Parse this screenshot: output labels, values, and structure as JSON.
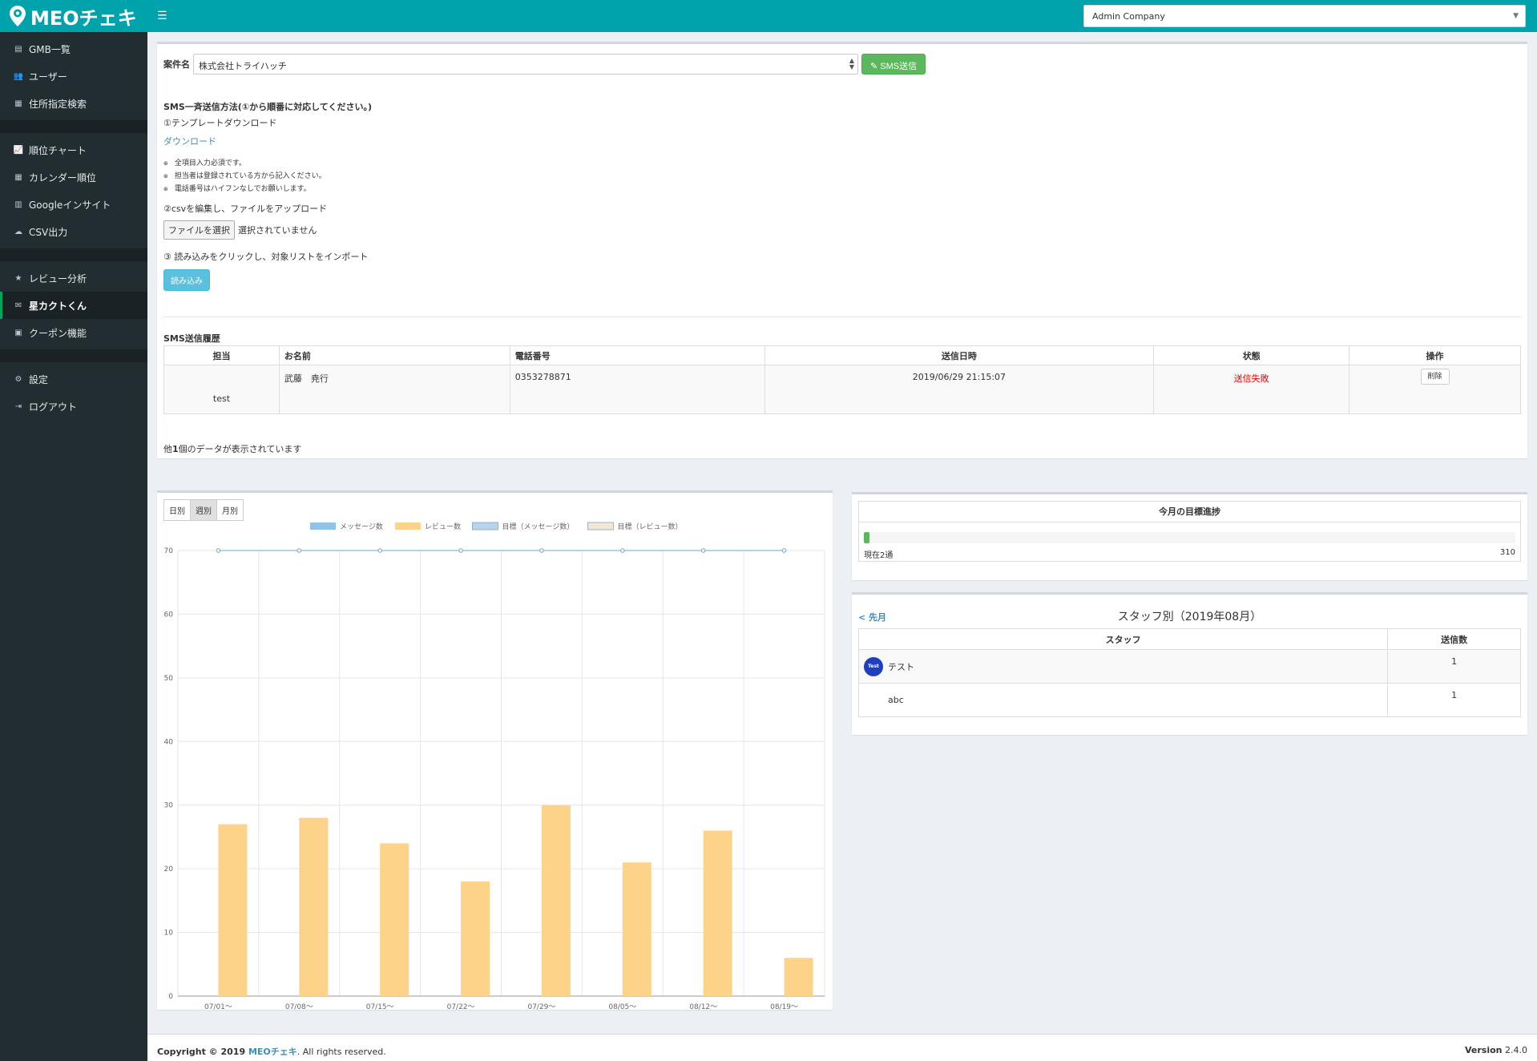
{
  "app": {
    "logo_text": "MEOチェキ"
  },
  "topbar": {
    "company": "Admin Company"
  },
  "sidebar": {
    "groups": [
      [
        {
          "label": "GMB一覧",
          "icon": "database-icon"
        },
        {
          "label": "ユーザー",
          "icon": "users-icon"
        },
        {
          "label": "住所指定検索",
          "icon": "map-icon"
        }
      ],
      [
        {
          "label": "順位チャート",
          "icon": "line-chart-icon"
        },
        {
          "label": "カレンダー順位",
          "icon": "calendar-icon"
        },
        {
          "label": "Googleインサイト",
          "icon": "bar-chart-icon"
        },
        {
          "label": "CSV出力",
          "icon": "cloud-download-icon"
        }
      ],
      [
        {
          "label": "レビュー分析",
          "icon": "star-icon"
        },
        {
          "label": "星カクトくん",
          "icon": "envelope-icon",
          "active": true
        },
        {
          "label": "クーポン機能",
          "icon": "gift-icon"
        }
      ],
      [
        {
          "label": "設定",
          "icon": "gear-icon"
        },
        {
          "label": "ログアウト",
          "icon": "sign-out-icon"
        }
      ]
    ]
  },
  "case": {
    "label": "案件名",
    "selected": "株式会社トライハッチ",
    "sms_button": "SMS送信"
  },
  "instructions": {
    "heading": "SMS一斉送信方法(①から順番に対応してください。)",
    "step1": "①テンプレートダウンロード",
    "download_link": "ダウンロード",
    "notes": [
      "全項目入力必須です。",
      "担当者は登録されている方から記入ください。",
      "電話番号はハイフンなしでお願いします。"
    ],
    "step2": "②csvを編集し、ファイルをアップロード",
    "file_button": "ファイルを選択",
    "file_status": "選択されていません",
    "step3": "③ 読み込みをクリックし、対象リストをインポート",
    "load_button": "読み込み"
  },
  "history": {
    "title": "SMS送信履歴",
    "columns": [
      "担当",
      "お名前",
      "電話番号",
      "送信日時",
      "状態",
      "操作"
    ],
    "rows": [
      {
        "staff": "test",
        "name": "武藤　尭行",
        "phone": "0353278871",
        "sent_at": "2019/06/29 21:15:07",
        "status": "送信失敗",
        "action": "削除"
      }
    ],
    "count_prefix": "他",
    "count_value": "1",
    "count_suffix": "個のデータが表示されています"
  },
  "chart_tabs": [
    "日別",
    "週別",
    "月別"
  ],
  "chart_tab_active": 1,
  "chart_data": {
    "type": "bar",
    "categories": [
      "07/01～",
      "07/08～",
      "07/15～",
      "07/22～",
      "07/29～",
      "08/05～",
      "08/12～",
      "08/19～"
    ],
    "series": [
      {
        "name": "メッセージ数",
        "type": "bar",
        "color": "#8ec3ea",
        "values": [
          0,
          0,
          0,
          0,
          0,
          0,
          0,
          0
        ]
      },
      {
        "name": "レビュー数",
        "type": "bar",
        "color": "#fdd38a",
        "values": [
          27,
          28,
          24,
          18,
          30,
          21,
          26,
          6
        ]
      },
      {
        "name": "目標（メッセージ数）",
        "type": "line",
        "color": "#b9d4ea",
        "values": [
          70,
          70,
          70,
          70,
          70,
          70,
          70,
          70
        ]
      },
      {
        "name": "目標（レビュー数）",
        "type": "line",
        "color": "#f3e6d2",
        "values": [
          70,
          70,
          70,
          70,
          70,
          70,
          70,
          70
        ]
      }
    ],
    "ylim": [
      0,
      70
    ],
    "yticks": [
      0,
      10,
      20,
      30,
      40,
      50,
      60,
      70
    ],
    "grid": true,
    "legend": "top"
  },
  "goal": {
    "title": "今月の目標進捗",
    "current_label": "現在2通",
    "current": 2,
    "target": "310"
  },
  "staff": {
    "prev_link": "< 先月",
    "title": "スタッフ別（2019年08月）",
    "columns": [
      "スタッフ",
      "送信数"
    ],
    "rows": [
      {
        "name": "テスト",
        "count": "1",
        "avatar": true,
        "avatar_text": "Test"
      },
      {
        "name": "abc",
        "count": "1",
        "avatar": false
      }
    ]
  },
  "footer": {
    "copyright_prefix": "Copyright © 2019 ",
    "brand": "MEOチェキ",
    "copyright_suffix": ". All rights reserved.",
    "version_label": "Version",
    "version": "2.4.0"
  }
}
